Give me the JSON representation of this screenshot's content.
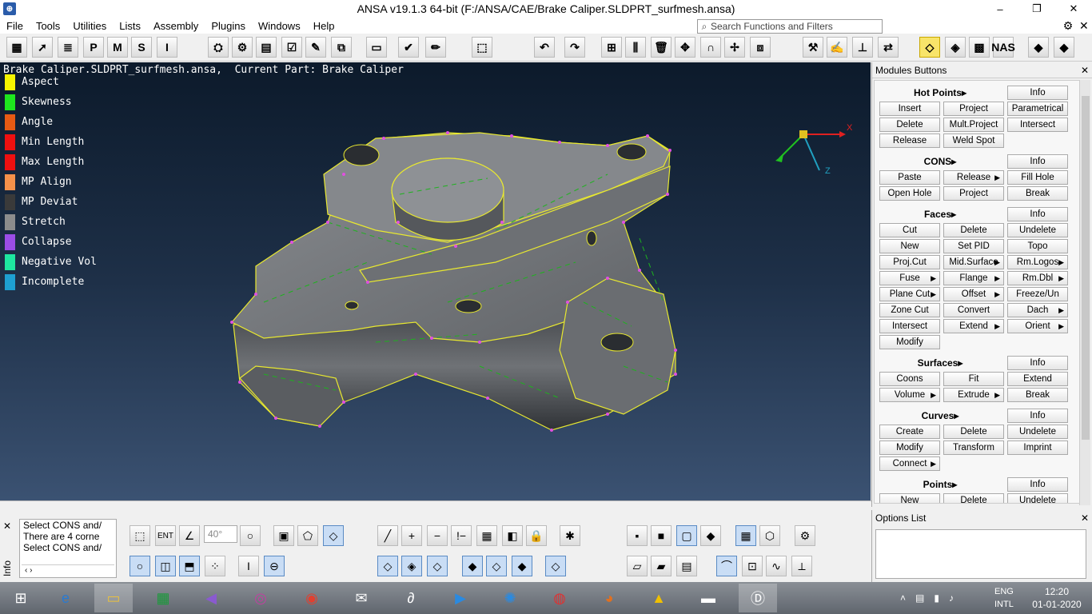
{
  "window": {
    "title": "ANSA v19.1.3 64-bit (F:/ANSA/CAE/Brake Caliper.SLDPRT_surfmesh.ansa)",
    "minimize": "–",
    "maximize": "❐",
    "close": "✕"
  },
  "menu": [
    "File",
    "Tools",
    "Utilities",
    "Lists",
    "Assembly",
    "Plugins",
    "Windows",
    "Help"
  ],
  "search": {
    "placeholder": "Search Functions and Filters"
  },
  "viewport": {
    "header": "Brake Caliper.SLDPRT_surfmesh.ansa,  Current Part: Brake Caliper",
    "legend": [
      {
        "label": "Aspect",
        "color": "#f5f500"
      },
      {
        "label": "Skewness",
        "color": "#1ee61e"
      },
      {
        "label": "Angle",
        "color": "#e65a14"
      },
      {
        "label": "Min Length",
        "color": "#ee1010"
      },
      {
        "label": "Max Length",
        "color": "#ee1010"
      },
      {
        "label": "MP Align",
        "color": "#f5914a"
      },
      {
        "label": "MP Deviat",
        "color": "#3a3a3a"
      },
      {
        "label": "Stretch",
        "color": "#8c8c8c"
      },
      {
        "label": "Collapse",
        "color": "#9b4de6"
      },
      {
        "label": "Negative Vol",
        "color": "#1ee6a0"
      },
      {
        "label": "Incomplete",
        "color": "#1ea0d2"
      }
    ],
    "axes": {
      "x": "X",
      "z": "Z"
    }
  },
  "modules": {
    "title": "Modules Buttons",
    "sections": [
      {
        "name": "Hot Points",
        "info": "Info",
        "buttons": [
          [
            "Insert",
            "Project",
            "Parametrical"
          ],
          [
            "Delete",
            "Mult.Project",
            "Intersect"
          ],
          [
            "Release",
            "Weld Spot",
            ""
          ]
        ]
      },
      {
        "name": "CONS",
        "info": "Info",
        "buttons": [
          [
            "Paste",
            "Release",
            "Fill Hole"
          ],
          [
            "Open Hole",
            "Project",
            "Break"
          ]
        ]
      },
      {
        "name": "Faces",
        "info": "Info",
        "buttons": [
          [
            "Cut",
            "Delete",
            "Undelete"
          ],
          [
            "New",
            "Set PID",
            "Topo"
          ],
          [
            "Proj.Cut",
            "Mid.Surface",
            "Rm.Logos"
          ],
          [
            "Fuse",
            "Flange",
            "Rm.Dbl"
          ],
          [
            "Plane Cut",
            "Offset",
            "Freeze/Un"
          ],
          [
            "Zone Cut",
            "Convert",
            "Dach"
          ],
          [
            "Intersect",
            "Extend",
            "Orient"
          ],
          [
            "Modify",
            "",
            ""
          ]
        ]
      },
      {
        "name": "Surfaces",
        "info": "Info",
        "buttons": [
          [
            "Coons",
            "Fit",
            "Extend"
          ],
          [
            "Volume",
            "Extrude",
            "Break"
          ]
        ]
      },
      {
        "name": "Curves",
        "info": "Info",
        "buttons": [
          [
            "Create",
            "Delete",
            "Undelete"
          ],
          [
            "Modify",
            "Transform",
            "Imprint"
          ],
          [
            "Connect",
            "",
            ""
          ]
        ]
      },
      {
        "name": "Points",
        "info": "Info",
        "buttons": [
          [
            "New",
            "Delete",
            "Undelete"
          ]
        ]
      }
    ]
  },
  "options": {
    "title": "Options List"
  },
  "messages": {
    "lines": [
      "Select CONS and/",
      "There are 4 corne",
      "Select CONS and/"
    ],
    "label": "Info"
  },
  "bottom": {
    "angle": "40°",
    "ent": "ENT"
  },
  "taskbar": {
    "lang1": "ENG",
    "lang2": "INTL",
    "time": "12:20",
    "date": "01-01-2020"
  }
}
